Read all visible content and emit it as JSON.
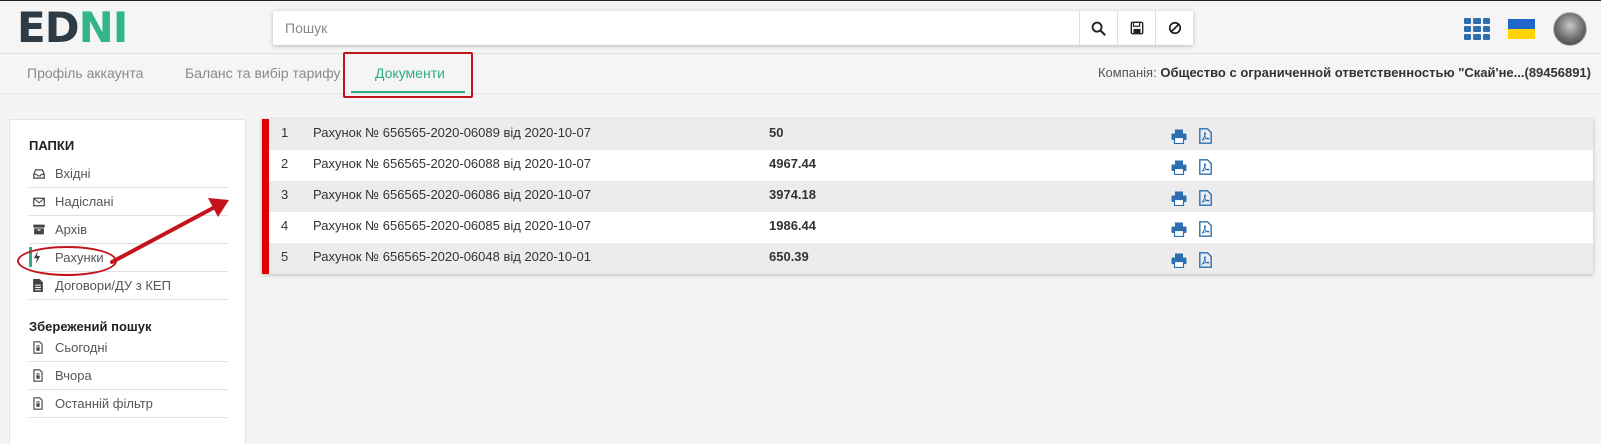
{
  "app": {
    "logo_main": "ED",
    "logo_accent": "N",
    "logo_end": "I"
  },
  "search": {
    "placeholder": "Пошук",
    "value": ""
  },
  "header_icons": {
    "search": "search-icon",
    "save": "save-icon",
    "clear": "ban-icon",
    "apps": "apps-grid-icon",
    "language": "ukraine-flag-icon",
    "avatar": "user-avatar"
  },
  "tabs": [
    {
      "label": "Профіль аккаунта",
      "active": false
    },
    {
      "label": "Баланс та вибір тарифу",
      "active": false
    },
    {
      "label": "Документи",
      "active": true
    }
  ],
  "company": {
    "label": "Компанія:",
    "name": "Общество с ограниченной ответственностью \"Скай'не...(89456891)"
  },
  "sidebar": {
    "folders_title": "Папки",
    "folders": [
      {
        "label": "Вхідні",
        "icon": "inbox-icon"
      },
      {
        "label": "Надіслані",
        "icon": "envelope-icon"
      },
      {
        "label": "Архів",
        "icon": "archive-icon"
      },
      {
        "label": "Рахунки",
        "icon": "bolt-icon",
        "active": true
      },
      {
        "label": "Договори/ДУ з КЕП",
        "icon": "file-text-icon"
      }
    ],
    "saved_title": "Збережений пошук",
    "saved": [
      {
        "label": "Сьогодні",
        "icon": "file-lock-icon"
      },
      {
        "label": "Вчора",
        "icon": "file-lock-icon"
      },
      {
        "label": "Останній фільтр",
        "icon": "file-lock-icon"
      }
    ]
  },
  "documents": [
    {
      "num": "1",
      "name": "Рахунок № 656565-2020-06089 від 2020-10-07",
      "amount": "50"
    },
    {
      "num": "2",
      "name": "Рахунок № 656565-2020-06088 від 2020-10-07",
      "amount": "4967.44"
    },
    {
      "num": "3",
      "name": "Рахунок № 656565-2020-06086 від 2020-10-07",
      "amount": "3974.18"
    },
    {
      "num": "4",
      "name": "Рахунок № 656565-2020-06085 від 2020-10-07",
      "amount": "1986.44"
    },
    {
      "num": "5",
      "name": "Рахунок № 656565-2020-06048 від 2020-10-01",
      "amount": "650.39"
    }
  ],
  "colors": {
    "accent": "#2fae86",
    "annotation": "#c2141a",
    "row_marker": "#e00000",
    "icon_blue": "#2c6fb0"
  }
}
